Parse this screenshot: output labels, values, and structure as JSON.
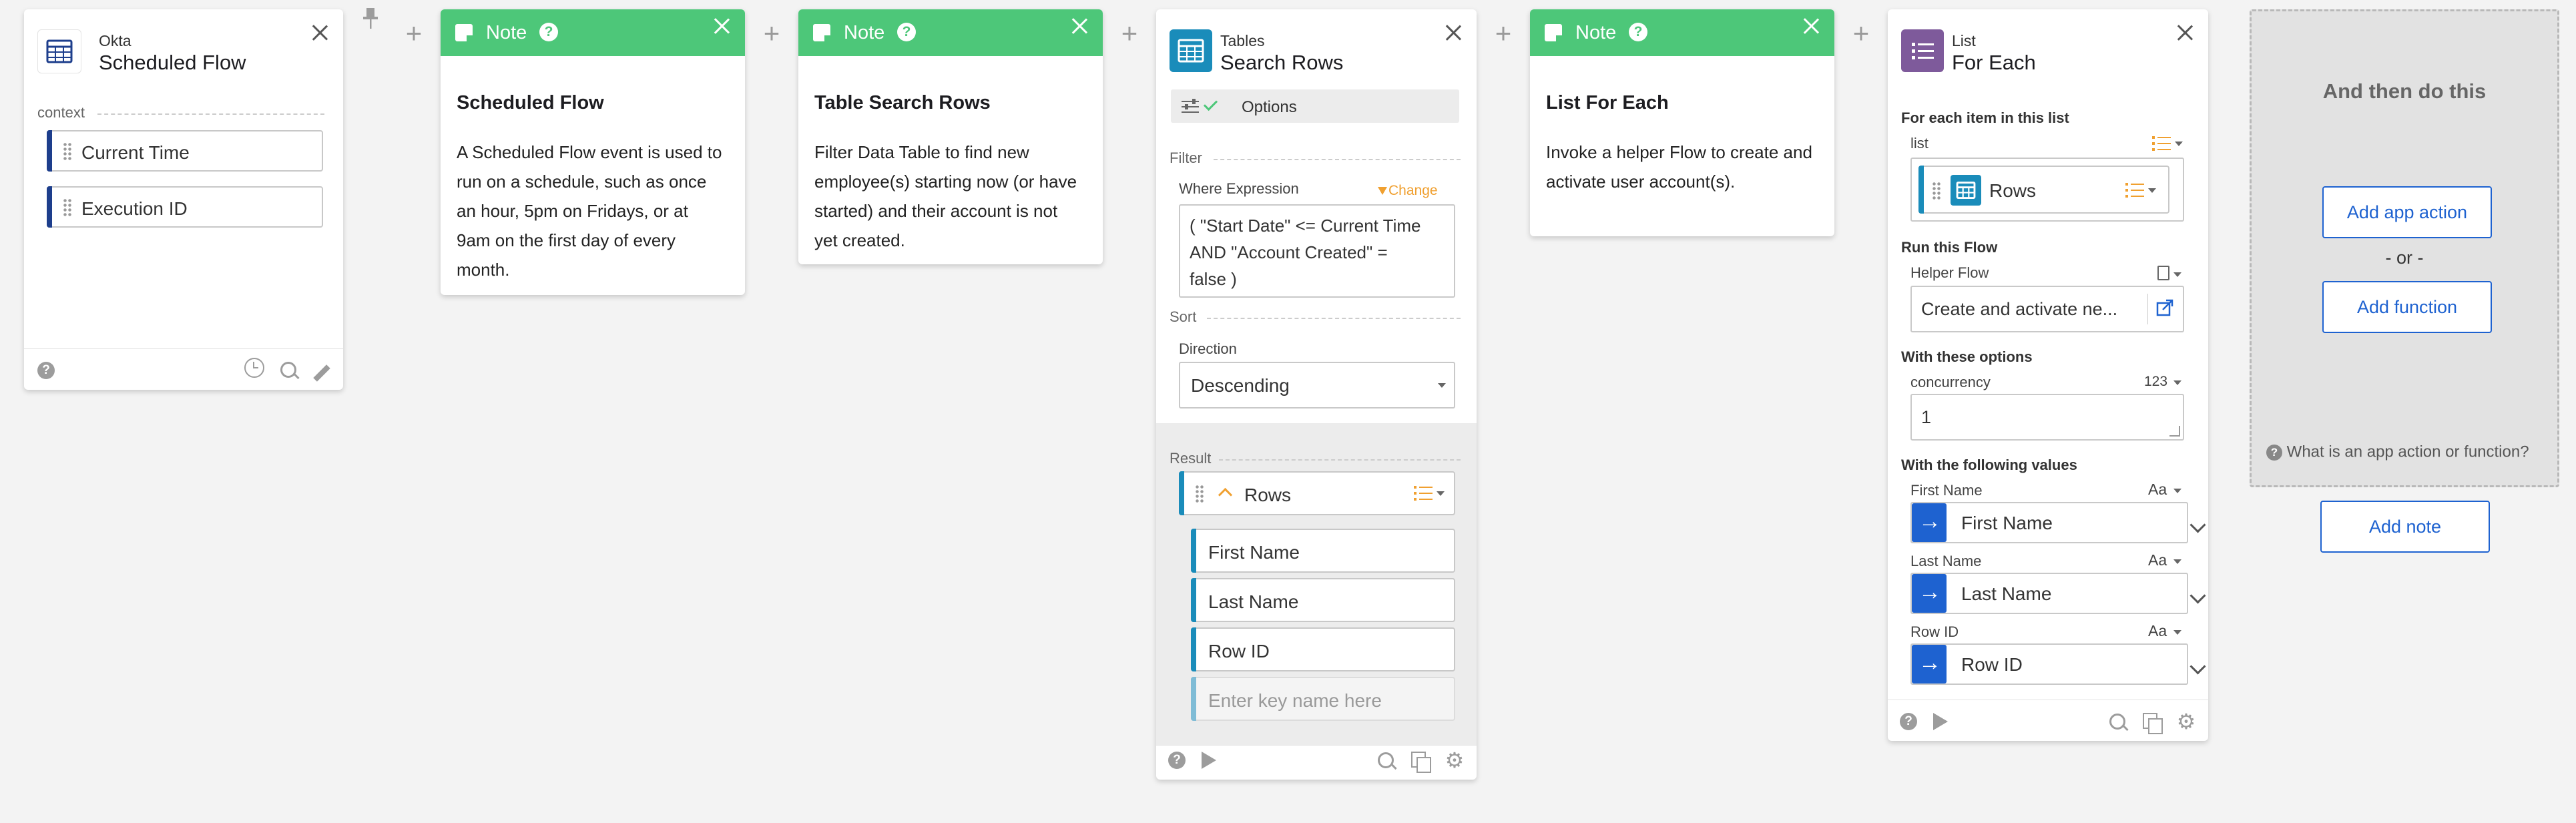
{
  "trigger_card": {
    "app_name": "Okta",
    "title": "Scheduled Flow",
    "context_label": "context",
    "outputs": [
      "Current Time",
      "Execution ID"
    ]
  },
  "notes": [
    {
      "label": "Note",
      "title": "Scheduled Flow",
      "body": "A Scheduled Flow event is used to run on a schedule, such as once an hour, 5pm on Fridays, or at 9am on the first day of every month."
    },
    {
      "label": "Note",
      "title": "Table Search Rows",
      "body": "Filter Data Table to find new employee(s) starting now (or have started) and their account is not yet created."
    },
    {
      "label": "Note",
      "title": "List For Each",
      "body": "Invoke a helper Flow to create and activate user account(s)."
    }
  ],
  "tables_card": {
    "app_name": "Tables",
    "title": "Search Rows",
    "options_label": "Options",
    "filter_label": "Filter",
    "where_label": "Where Expression",
    "change_label": "Change",
    "expression_line1": "( \"Start Date\" <= Current Time",
    "expression_line2": "AND \"Account Created\" =",
    "expression_line3": "false )",
    "sort_label": "Sort",
    "direction_label": "Direction",
    "direction_value": "Descending",
    "result_label": "Result",
    "rows_label": "Rows",
    "row_fields": [
      "First Name",
      "Last Name",
      "Row ID"
    ],
    "key_placeholder": "Enter key name here"
  },
  "list_card": {
    "app_name": "List",
    "title": "For Each",
    "for_each_label": "For each item in this list",
    "list_label": "list",
    "list_value": "Rows",
    "run_flow_label": "Run this Flow",
    "helper_flow_label": "Helper Flow",
    "helper_flow_value": "Create and activate ne...",
    "options_label": "With these options",
    "concurrency_label": "concurrency",
    "concurrency_type": "123",
    "concurrency_value": "1",
    "values_label": "With the following values",
    "values": [
      {
        "label": "First Name",
        "type": "Aa",
        "value": "First Name"
      },
      {
        "label": "Last Name",
        "type": "Aa",
        "value": "Last Name"
      },
      {
        "label": "Row ID",
        "type": "Aa",
        "value": "Row ID"
      }
    ]
  },
  "then_panel": {
    "title": "And then do this",
    "add_app_action": "Add app action",
    "or_label": "- or -",
    "add_function": "Add function",
    "help_link": "What is an app action or function?",
    "add_note": "Add note"
  },
  "colors": {
    "note_green": "#4dc779",
    "okta_blue": "#1d3e8c",
    "tables_teal": "#1a8cba",
    "list_purple": "#7e5a9b",
    "link_blue": "#1e62d0",
    "change_orange": "#f0a030"
  }
}
